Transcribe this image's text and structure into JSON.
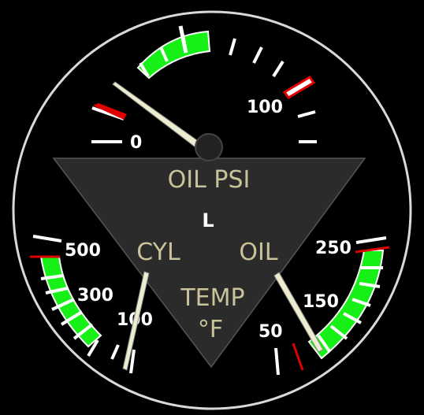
{
  "instrument": {
    "title": "OIL PSI",
    "side": "L",
    "left_label": "CYL",
    "right_label": "OIL",
    "temp_label": "TEMP",
    "unit_label": "°F"
  },
  "oil_pressure": {
    "tick_labels": [
      "0",
      "100"
    ],
    "needle_value": 8
  },
  "cyl_temp": {
    "tick_labels": [
      "500",
      "300",
      "100"
    ],
    "needle_value": 100
  },
  "oil_temp": {
    "tick_labels": [
      "250",
      "150",
      "50"
    ],
    "needle_value": 60
  },
  "colors": {
    "background": "#000000",
    "bezel": "#d9d9d9",
    "green_arc": "#16f016",
    "red_mark": "#e00000",
    "needle": "#eeeccf",
    "panel": "#2b2b2b",
    "panel_text": "#c9c39a"
  }
}
